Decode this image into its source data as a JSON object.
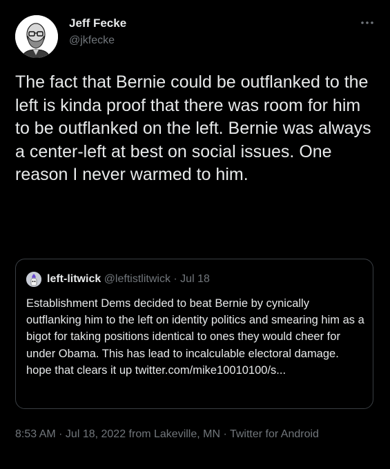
{
  "author": {
    "name": "Jeff Fecke",
    "handle": "@jkfecke",
    "avatar_icon": "bald-bearded-man-with-glasses-avatar"
  },
  "more_icon": "three-dots-menu-icon",
  "tweet_text": "The fact that Bernie could be outflanked to the left is kinda proof that there was room for him to be outflanked on the left. Bernie was always a center-left at best on social issues. One reason I never warmed to him.",
  "quoted_tweet": {
    "name": "left-litwick",
    "handle": "@leftistlitwick",
    "separator": "·",
    "date": "Jul 18",
    "avatar_icon": "litwick-candle-avatar",
    "text": "Establishment Dems decided to beat Bernie by cynically outflanking him to the left on identity politics and smearing him as a bigot for taking positions identical to ones they would cheer for under Obama. This has lead to incalculable electoral damage. hope that clears it up twitter.com/mike10010100/s..."
  },
  "footer": {
    "time": "8:53 AM",
    "sep1": " · ",
    "date": "Jul 18, 2022 from Lakeville, MN",
    "sep2": " · ",
    "source": "Twitter for Android"
  },
  "colors": {
    "background": "#000000",
    "primary_text": "#e7e9ea",
    "secondary_text": "#71767b",
    "border": "#3a3f44"
  }
}
